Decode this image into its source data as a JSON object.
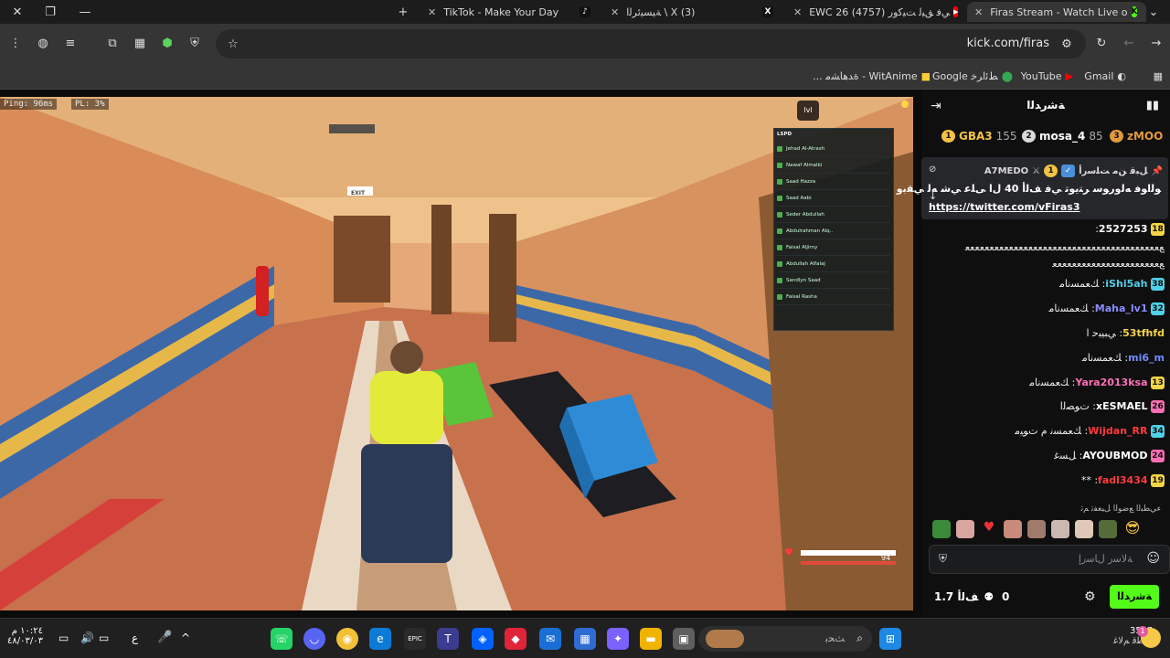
{
  "tabs": [
    {
      "title": "Firas Stream - Watch Live o",
      "active": true
    },
    {
      "title": "EWC 26 ﻲﻓ ﻖﻴﻟ ﺖﻴﻛﻭﺭ (4757)"
    },
    {
      "title": "ﺔﻴﺴﻴﺋﺮﻟﺍ \\ X (3)"
    },
    {
      "title": "TikTok - Make Your Day"
    }
  ],
  "address": {
    "url": "kick.com/firas"
  },
  "bookmarks": [
    {
      "label": "Gmail"
    },
    {
      "label": "YouTube"
    },
    {
      "label": "Google ﻂﺋﺍﺮﺧ"
    },
    {
      "label": "... ﺓﺪﻫﺎﺸﻣ - WitAnime"
    }
  ],
  "video": {
    "ping": "Ping: 96ms",
    "pl": "PL: 3%",
    "exit_sign": "EXIT",
    "scoreboard": [
      "Jehad Al-Atrash",
      "Nawaf Almalki",
      "Saad Hazza",
      "Saad Aabi",
      "Seder Abdullah",
      "Abdulrahman Alq..",
      "Faisal Aljirny",
      "Abdullah Alfalaj",
      "Sandlyn Saad",
      "Faisal Rasha"
    ],
    "health_value": "94"
  },
  "chat": {
    "title": "ﺔﺷﺭﺪﻟﺍ",
    "leaderboard": [
      {
        "rank": "1",
        "name": "GBA3",
        "score": "155",
        "color": "#f5c242"
      },
      {
        "rank": "2",
        "name": "mosa_4",
        "score": "85",
        "color": "#d9d9d9"
      },
      {
        "rank": "3",
        "name": "zMOO",
        "score": "",
        "color": "#e39a3b"
      }
    ],
    "pinned": {
      "sent_by": "ﻞﺒﻗ ﻦﻣ ﺖﻠﺳﺭﺃ",
      "user": "A7MEDO",
      "text": "ﻮﻟﺍﻮﻓ ﻪﻟﻭﺭﻮﺳ ﺮﺘﻳﻮﺗ ﻲﻓ ﻒﻟﺃ 40 ﻝﺍ ﻰﻠﻋ ﻲﺷ ﻪﻟ ﻲﻘﺑﻭ",
      "link": "https://twitter.com/vFiras3"
    },
    "messages": [
      {
        "badge": "18",
        "badge_color": "#f5d547",
        "user": "2527253",
        "user_color": "#ffffff",
        "text": ""
      },
      {
        "badge": "",
        "user": "",
        "text": "ﻊﻌﻌﻌﻌﻌﻌﻌﻌﻌﻌﻌﻌﻌﻌﻌﻌﻌﻌﻌﻌﻌﻌﻌﻌﻌﻌﻌﻌﻌﻌﻌﻌﻌﻌﻌﻌﻌﻌﻌﻌ"
      },
      {
        "badge": "",
        "user": "",
        "text": "ﻊﻌﻌﻌﻌﻌﻌﻌﻌﻌﻌﻌﻌﻌﻌﻌﻌﻌﻌﻌﻌﻌﻌ"
      },
      {
        "badge": "38",
        "badge_color": "#4fd1e8",
        "user": "iShi5ah",
        "user_color": "#4fd1e8",
        "text": "ﻚﻌﻤﺴﻧﺎﻣ"
      },
      {
        "badge": "32",
        "badge_color": "#4fd1e8",
        "user": "Maha_lv1",
        "user_color": "#8a8dff",
        "text": "ﻚﻌﻤﺴﻧﺎﻣ"
      },
      {
        "badge": "",
        "user": "53tfhfd",
        "user_color": "#f5d547",
        "text": "ﻲﺒﻴﺒﺣ ﺍ"
      },
      {
        "badge": "",
        "user": "mi6_m",
        "user_color": "#6f8cff",
        "text": "ﻚﻌﻤﺴﻧﺎﻣ"
      },
      {
        "badge": "13",
        "badge_color": "#f5d547",
        "user": "Yara2013ksa",
        "user_color": "#ff6fb5",
        "text": "ﻚﻌﻤﺴﻧﺎﻣ"
      },
      {
        "badge": "26",
        "badge_color": "#ff6fb5",
        "user": "xESMAEL",
        "user_color": "#ffffff",
        "text": "ﺕﻮﺼﻟﺍ"
      },
      {
        "badge": "34",
        "badge_color": "#4fd1e8",
        "user": "Wijdan_RR",
        "user_color": "#ff3b3b",
        "text": "ﻚﻌﻤﺴﻧ ﻡ ﺕﻮﻴﻣ"
      },
      {
        "badge": "24",
        "badge_color": "#ff6fb5",
        "user": "AYOUBMOD",
        "user_color": "#ffffff",
        "text": "ﻞﺴﻏ"
      },
      {
        "badge": "19",
        "badge_color": "#f5d547",
        "user": "fadl3434",
        "user_color": "#ff3b3b",
        "text": "**"
      }
    ],
    "slowmode_note": "ﺀﻲﻄﺒﻟﺍ ﻊﺿﻮﻟﺍ ﻞﻴﻌﻔﺗ ﻢﺗ",
    "input_placeholder": "ﺔﻟﺎﺳﺭ ﻝﺎﺳﺭﺇ",
    "chat_button": "ﺔﺷﺭﺪﻟﺍ",
    "points": "0",
    "viewers": "1.7 ﻒﻟﺃ"
  },
  "taskbar": {
    "weather_temp": "35°C",
    "weather_text": "ﻉﺎﻄﻗ ﻢﻟﺎﻏ",
    "search_placeholder": "ﺚﺤﺑ",
    "time": "١٠:٢٤ م",
    "date": "٤٨/٠٣/٠٣",
    "lang": "ع",
    "notif_count": "1"
  }
}
